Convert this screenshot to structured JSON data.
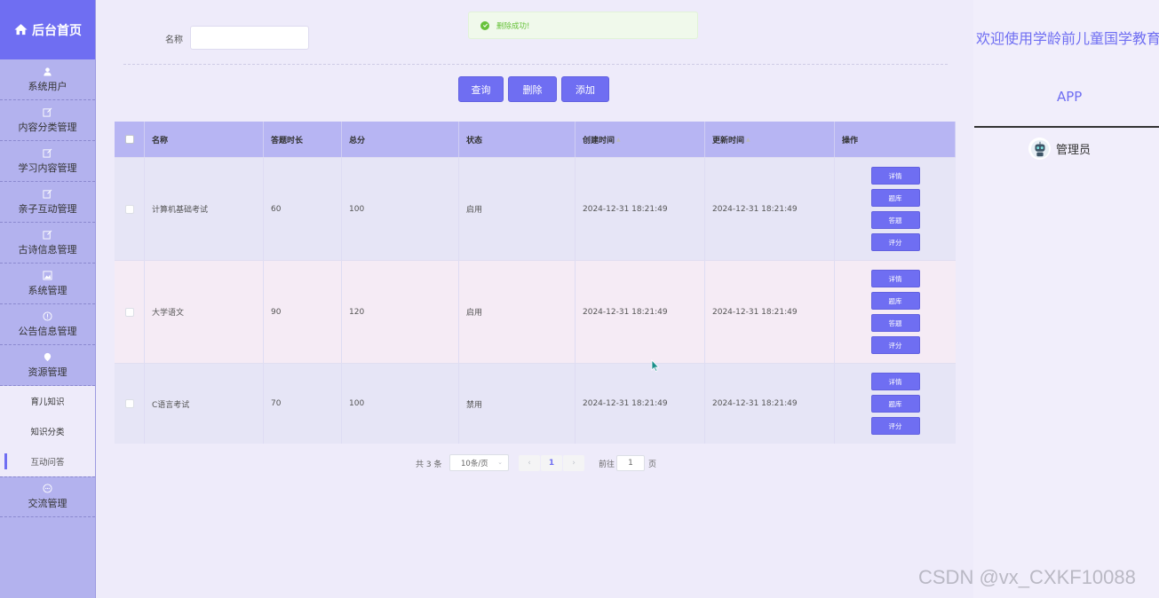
{
  "brand": {
    "title": "后台首页",
    "icon": "home-icon"
  },
  "sidebar": {
    "items": [
      {
        "label": "系统用户",
        "icon": "user-icon"
      },
      {
        "label": "内容分类管理",
        "icon": "edit-icon"
      },
      {
        "label": "学习内容管理",
        "icon": "edit-icon"
      },
      {
        "label": "亲子互动管理",
        "icon": "edit-icon"
      },
      {
        "label": "古诗信息管理",
        "icon": "edit-icon"
      },
      {
        "label": "系统管理",
        "icon": "picture-icon"
      },
      {
        "label": "公告信息管理",
        "icon": "info-icon"
      },
      {
        "label": "资源管理",
        "icon": "location-icon"
      }
    ],
    "subitems": [
      {
        "label": "育儿知识"
      },
      {
        "label": "知识分类"
      },
      {
        "label": "互动问答"
      }
    ],
    "last_item": {
      "label": "交流管理",
      "icon": "chat-icon"
    }
  },
  "search": {
    "label": "名称",
    "value": "",
    "placeholder": ""
  },
  "toolbar": {
    "query": "查询",
    "delete": "删除",
    "add": "添加"
  },
  "toast": {
    "message": "删除成功!"
  },
  "table": {
    "headers": {
      "name": "名称",
      "duration": "答题时长",
      "score": "总分",
      "status": "状态",
      "created": "创建时间",
      "updated": "更新时间",
      "actions": "操作"
    },
    "rows": [
      {
        "name": "计算机基础考试",
        "duration": "60",
        "score": "100",
        "status": "启用",
        "created": "2024-12-31 18:21:49",
        "updated": "2024-12-31 18:21:49",
        "ops": [
          "详情",
          "题库",
          "答题",
          "评分"
        ]
      },
      {
        "name": "大学语文",
        "duration": "90",
        "score": "120",
        "status": "启用",
        "created": "2024-12-31 18:21:49",
        "updated": "2024-12-31 18:21:49",
        "ops": [
          "详情",
          "题库",
          "答题",
          "评分"
        ]
      },
      {
        "name": "C语言考试",
        "duration": "70",
        "score": "100",
        "status": "禁用",
        "created": "2024-12-31 18:21:49",
        "updated": "2024-12-31 18:21:49",
        "ops": [
          "详情",
          "题库",
          "评分"
        ]
      }
    ]
  },
  "pagination": {
    "total": "共 3 条",
    "page_size": "10条/页",
    "current": "1",
    "goto_prefix": "前往",
    "goto_value": "1",
    "goto_suffix": "页",
    "prev": "‹",
    "next": "›"
  },
  "header_right": {
    "welcome": "欢迎使用学龄前儿童国学教育",
    "app": "APP",
    "user": "管理员"
  },
  "watermark": "CSDN @vx_CXKF10088",
  "colors": {
    "accent": "#6f6ef2",
    "sidebar": "#b3b2ee",
    "success": "#67c23a"
  }
}
